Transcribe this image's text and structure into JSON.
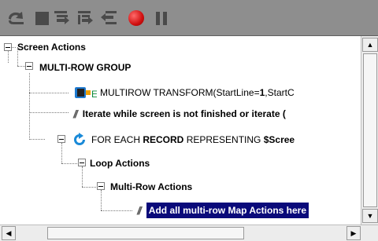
{
  "toolbar": {
    "buttons": [
      {
        "name": "undo-icon"
      },
      {
        "name": "stop-square-icon"
      },
      {
        "name": "step-into-icon"
      },
      {
        "name": "step-over-icon"
      },
      {
        "name": "step-out-icon"
      },
      {
        "name": "record-icon",
        "color": "#e01818"
      },
      {
        "name": "pause-icon"
      }
    ]
  },
  "tree": {
    "screen_actions": {
      "label": "Screen Actions"
    },
    "multirow_group": {
      "label": "MULTI-ROW GROUP"
    },
    "multirow_transform": {
      "prefix": "MULTIROW TRANSFORM(StartLine=",
      "value": "1",
      "suffix": ",StartC"
    },
    "iterate_comment": {
      "label": "Iterate while screen is not finished or iterate ("
    },
    "for_each": {
      "kw1": "FOR EACH ",
      "kw2": "RECORD",
      "kw3": " REPRESENTING ",
      "kw4": "$Scree"
    },
    "loop_actions": {
      "label": "Loop Actions"
    },
    "multirow_actions": {
      "label": "Multi-Row Actions"
    },
    "add_map_actions": {
      "label": "Add all multi-row Map Actions here"
    }
  },
  "colors": {
    "toolbar_bg": "#8e8e8e",
    "selection_bg": "#0a0a7a",
    "selection_fg": "#ffffff",
    "loop_icon": "#1a8ad8"
  }
}
